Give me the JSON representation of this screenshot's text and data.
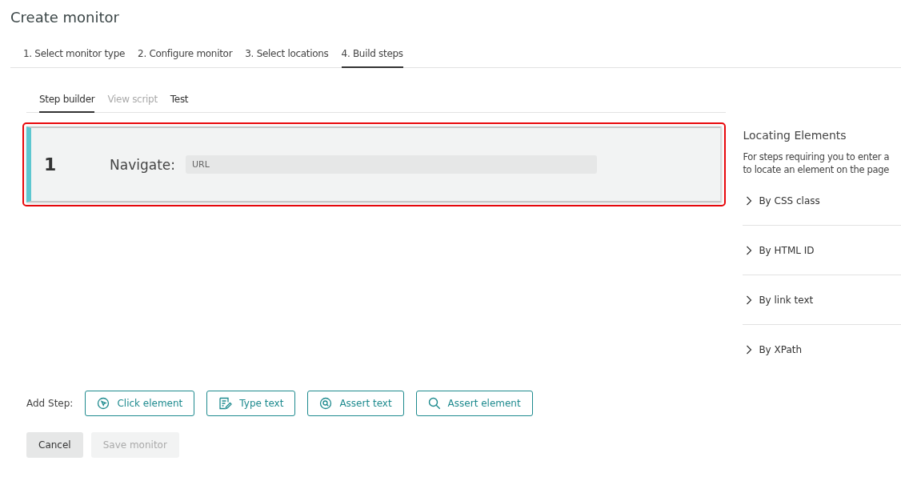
{
  "page": {
    "title": "Create monitor"
  },
  "wizard_tabs": [
    {
      "label": "1. Select monitor type",
      "selected": false
    },
    {
      "label": "2. Configure monitor",
      "selected": false
    },
    {
      "label": "3. Select locations",
      "selected": false
    },
    {
      "label": "4. Build steps",
      "selected": true
    }
  ],
  "sub_tabs": [
    {
      "label": "Step builder",
      "selected": true,
      "disabled": false
    },
    {
      "label": "View script",
      "selected": false,
      "disabled": true
    },
    {
      "label": "Test",
      "selected": false,
      "disabled": false
    }
  ],
  "steps": [
    {
      "number": "1",
      "action": "Navigate:",
      "placeholder": "URL",
      "highlighted": true
    }
  ],
  "help_panel": {
    "title": "Locating Elements",
    "text_lines": [
      "For steps requiring you to enter a",
      "to locate an element on the page"
    ],
    "sections": [
      {
        "label": "By CSS class",
        "expanded": false
      },
      {
        "label": "By HTML ID",
        "expanded": false
      },
      {
        "label": "By link text",
        "expanded": false
      },
      {
        "label": "By XPath",
        "expanded": false
      }
    ]
  },
  "add_step": {
    "label": "Add Step:",
    "buttons": [
      {
        "kind": "click",
        "label": "Click element"
      },
      {
        "kind": "type",
        "label": "Type text"
      },
      {
        "kind": "assert-text",
        "label": "Assert text"
      },
      {
        "kind": "assert-element",
        "label": "Assert element"
      }
    ]
  },
  "actions": [
    {
      "label": "Cancel",
      "disabled": false
    },
    {
      "label": "Save monitor",
      "disabled": true
    }
  ]
}
